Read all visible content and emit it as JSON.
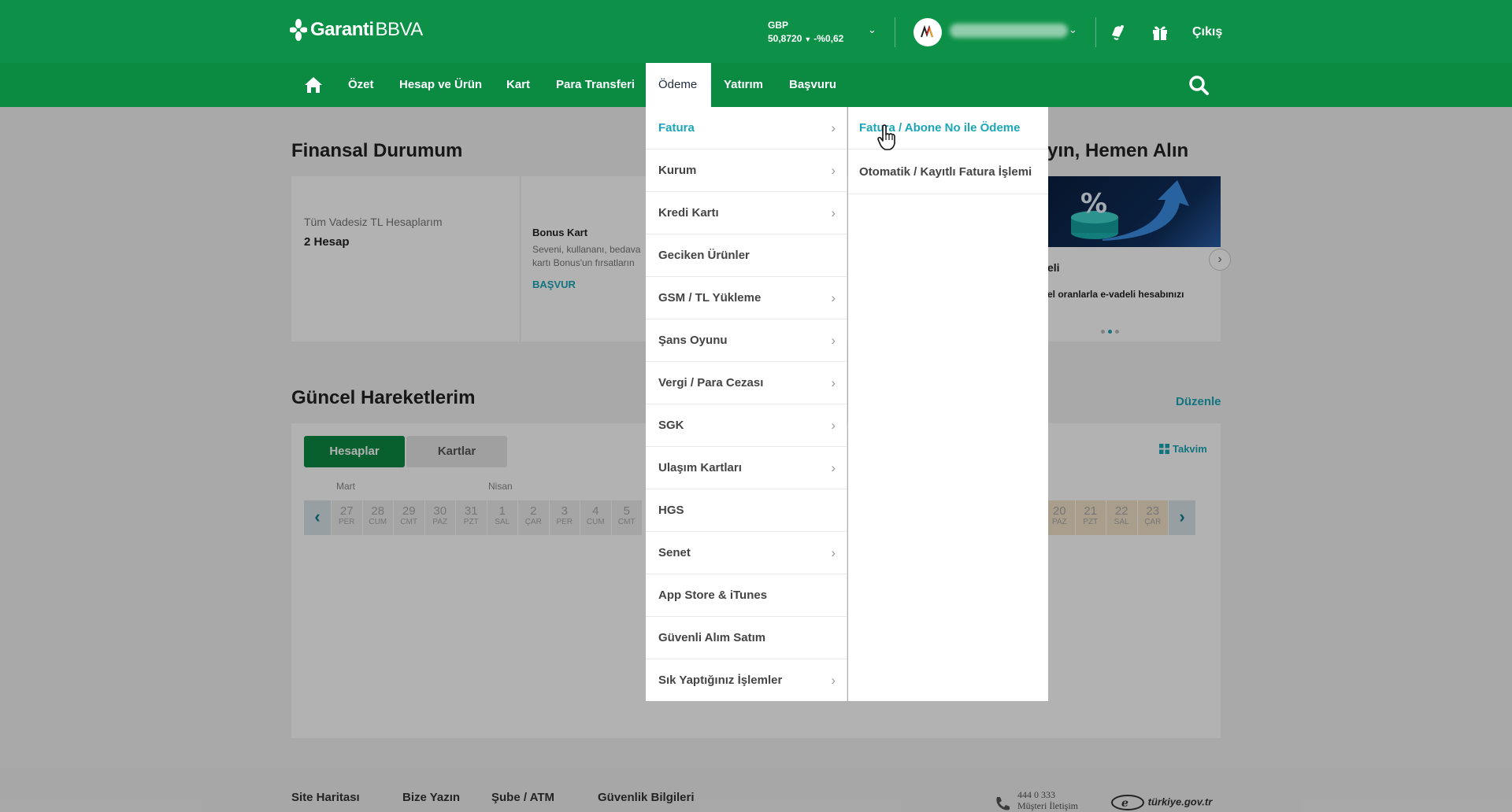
{
  "header": {
    "logo_text": "Garanti",
    "logo_suffix": "BBVA",
    "fx_currency": "GBP",
    "fx_rate": "50,8720",
    "fx_change": "-%0,62",
    "logout_label": "Çıkış"
  },
  "nav": {
    "items": [
      "Özet",
      "Hesap ve Ürün",
      "Kart",
      "Para Transferi",
      "Ödeme",
      "Yatırım",
      "Başvuru"
    ],
    "active": "Ödeme"
  },
  "finance": {
    "title": "Finansal Durumum",
    "accounts_label": "Tüm Vadesiz TL Hesaplarım",
    "accounts_count": "2 Hesap",
    "promo_title": "Bonus Kart",
    "promo_text_1": "Seveni, kullananı, bedava",
    "promo_text_2": "kartı Bonus'un fırsatların",
    "promo_apply": "BAŞVUR"
  },
  "campaign": {
    "title": "yın, Hemen Alın",
    "line1": "eli",
    "line2": "el oranlarla e-vadeli hesabınızı"
  },
  "activity": {
    "title": "Güncel Hareketlerim",
    "edit_label": "Düzenle",
    "tabs": [
      "Hesaplar",
      "Kartlar"
    ],
    "calendar_label": "Takvim",
    "months": [
      "Mart",
      "Nisan"
    ],
    "days_left": [
      {
        "d": "27",
        "w": "PER"
      },
      {
        "d": "28",
        "w": "CUM"
      },
      {
        "d": "29",
        "w": "CMT"
      },
      {
        "d": "30",
        "w": "PAZ"
      },
      {
        "d": "31",
        "w": "PZT"
      },
      {
        "d": "1",
        "w": "SAL"
      },
      {
        "d": "2",
        "w": "ÇAR"
      },
      {
        "d": "3",
        "w": "PER"
      },
      {
        "d": "4",
        "w": "CUM"
      },
      {
        "d": "5",
        "w": "CMT"
      }
    ],
    "days_right": [
      {
        "d": "20",
        "w": "PAZ"
      },
      {
        "d": "21",
        "w": "PZT"
      },
      {
        "d": "22",
        "w": "SAL"
      },
      {
        "d": "23",
        "w": "ÇAR"
      }
    ]
  },
  "footer": {
    "links": [
      "Site Haritası",
      "Bize Yazın",
      "Şube / ATM",
      "Güvenlik Bilgileri"
    ],
    "phone": "444 0 333",
    "phone_label": "Müşteri İletişim",
    "gov": "türkiye.gov.tr"
  },
  "menu": {
    "items": [
      {
        "label": "Fatura",
        "has_sub": true
      },
      {
        "label": "Kurum",
        "has_sub": true
      },
      {
        "label": "Kredi Kartı",
        "has_sub": true
      },
      {
        "label": "Geciken Ürünler",
        "has_sub": false
      },
      {
        "label": "GSM / TL Yükleme",
        "has_sub": true
      },
      {
        "label": "Şans Oyunu",
        "has_sub": true
      },
      {
        "label": "Vergi / Para Cezası",
        "has_sub": true
      },
      {
        "label": "SGK",
        "has_sub": true
      },
      {
        "label": "Ulaşım Kartları",
        "has_sub": true
      },
      {
        "label": "HGS",
        "has_sub": false
      },
      {
        "label": "Senet",
        "has_sub": true
      },
      {
        "label": "App Store & iTunes",
        "has_sub": false
      },
      {
        "label": "Güvenli Alım Satım",
        "has_sub": false
      },
      {
        "label": "Sık Yaptığınız İşlemler",
        "has_sub": true
      }
    ],
    "selected": "Fatura",
    "sub_items": [
      "Fatura / Abone No ile Ödeme",
      "Otomatik / Kayıtlı Fatura İşlemi"
    ]
  },
  "colors": {
    "brand_green": "#0d9148",
    "accent_teal": "#1aa6b7"
  }
}
